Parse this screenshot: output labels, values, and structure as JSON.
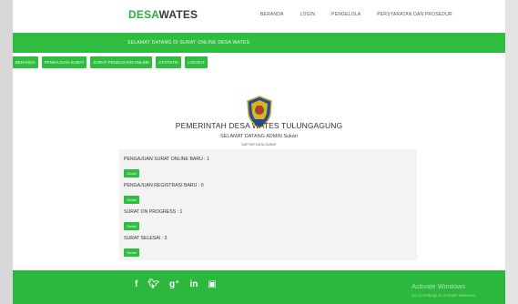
{
  "header": {
    "brand_part1": "DESA",
    "brand_part2": "WATES",
    "nav": [
      "BERANDA",
      "LOGIN",
      "PENGELOLA",
      "PERSYARATAN DAN PROSEDUR"
    ]
  },
  "welcome_bar": "SELAMAT DATANG DI SURAT ONLINE DESA WATES",
  "menu": [
    "BERANDA",
    "PENGAJUAN SURAT",
    "SURAT PENGAJUAN ONLINE",
    "STATISTIK",
    "LOGOUT"
  ],
  "content": {
    "title": "PEMERINTAH DESA WATES TULUNGAGUNG",
    "greeting": "SELAMAT DATANG ADMIN Sukari",
    "subtitle": "DAFTAR DATA SURAT"
  },
  "stats": [
    {
      "label": "PENGAJUAN SURAT ONLINE BARU : 1",
      "button": "Detail"
    },
    {
      "label": "PENGAJUAN REGISTRASI BARU : 0",
      "button": "Detail"
    },
    {
      "label": "SURAT ON PROGRESS : 1",
      "button": "Detail"
    },
    {
      "label": "SURAT SELESAI : 3",
      "button": "Detail"
    }
  ],
  "footer_social": [
    "facebook-icon",
    "twitter-icon",
    "google-plus-icon",
    "linkedin-icon",
    "youtube-icon"
  ],
  "watermark": {
    "title": "Activate Windows",
    "subtitle": "Go to Settings to activate Windows."
  },
  "colors": {
    "brand_green": "#2ebd3f",
    "footer_green": "#2cb83c"
  }
}
